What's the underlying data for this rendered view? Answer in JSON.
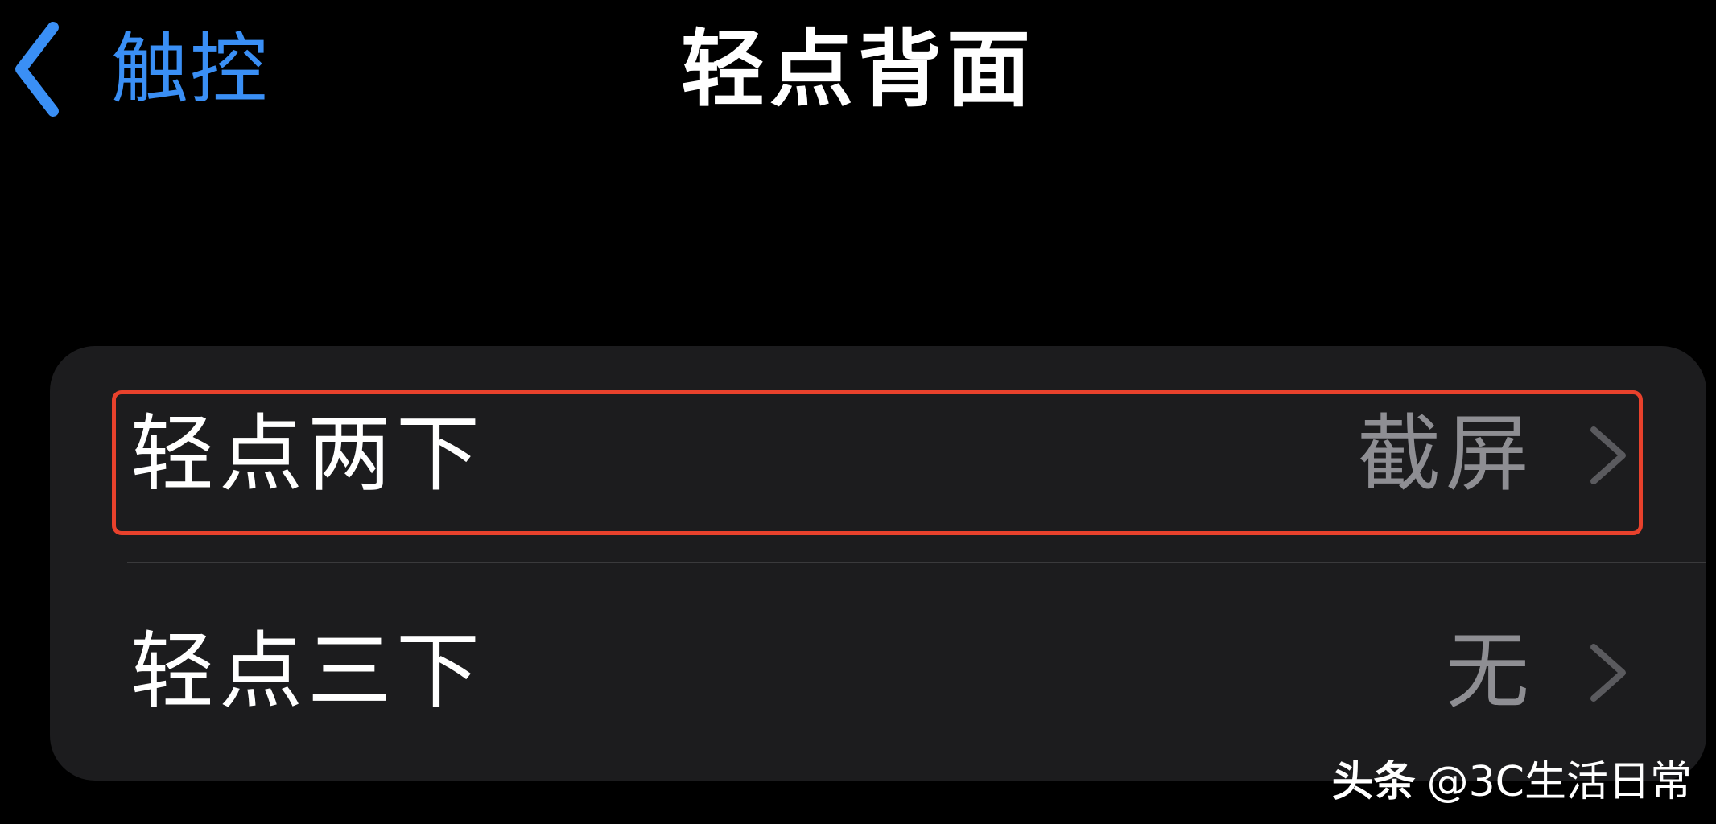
{
  "nav": {
    "back_label": "触控",
    "title": "轻点背面"
  },
  "settings": {
    "rows": [
      {
        "label": "轻点两下",
        "value": "截屏"
      },
      {
        "label": "轻点三下",
        "value": "无"
      }
    ]
  },
  "watermark": {
    "brand": "头条",
    "handle": "@3C生活日常"
  },
  "colors": {
    "accent": "#3a8ff5",
    "background": "#000000",
    "group_background": "#1c1c1e",
    "secondary_text": "#8e8e93",
    "highlight": "#e8412c"
  },
  "icons": {
    "back": "chevron-left-icon",
    "disclosure": "chevron-right-icon"
  }
}
